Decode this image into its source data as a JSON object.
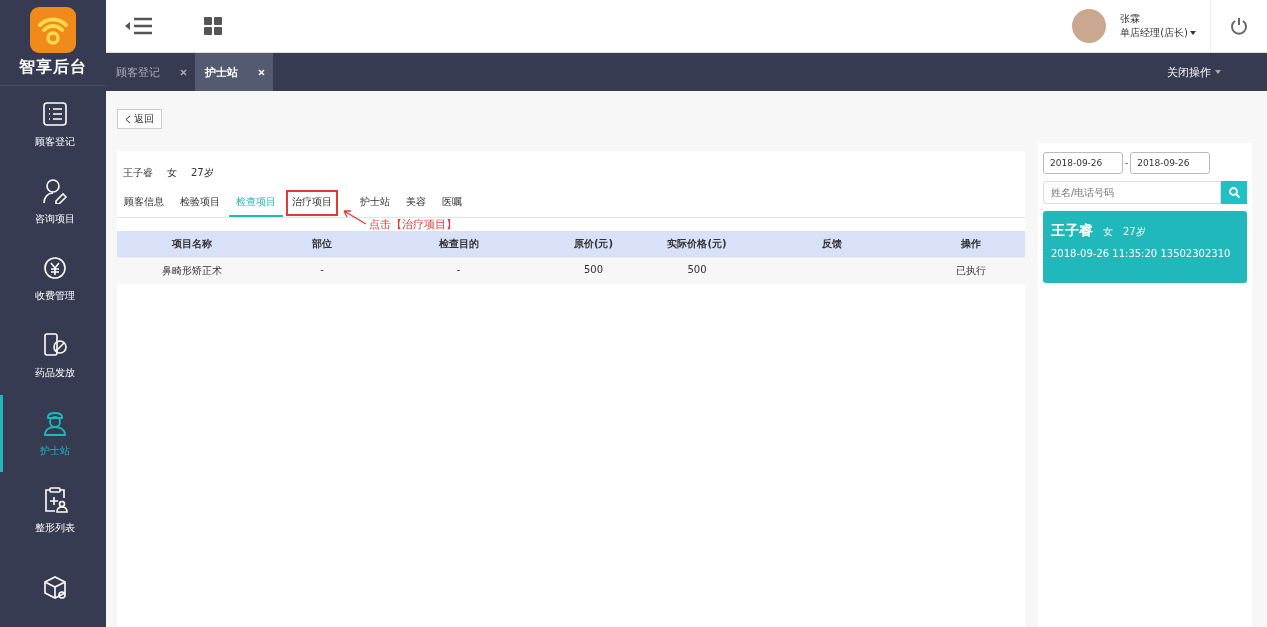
{
  "logo": {
    "title": "智享后台"
  },
  "sidebar": {
    "items": [
      {
        "label": "顾客登记",
        "selected": false
      },
      {
        "label": "咨询项目",
        "selected": false
      },
      {
        "label": "收费管理",
        "selected": false
      },
      {
        "label": "药品发放",
        "selected": false
      },
      {
        "label": "护士站",
        "selected": true
      },
      {
        "label": "整形列表",
        "selected": false
      },
      {
        "selected": false
      }
    ]
  },
  "header": {
    "user_name": "张霖",
    "user_role": "单店经理(店长)"
  },
  "page_tabs": {
    "items": [
      {
        "label": "顾客登记",
        "selected": false
      },
      {
        "label": "护士站",
        "selected": true
      }
    ],
    "close_all": "关闭操作"
  },
  "back_button": "返回",
  "patient": {
    "name": "王子睿",
    "gender": "女",
    "age": "27岁"
  },
  "tabs": [
    {
      "label": "顾客信息",
      "selected": false,
      "highlighted": false
    },
    {
      "label": "检验项目",
      "selected": false,
      "highlighted": false
    },
    {
      "label": "检查项目",
      "selected": true,
      "highlighted": false
    },
    {
      "label": "治疗项目",
      "selected": false,
      "highlighted": true
    },
    {
      "label": "护士站",
      "selected": false,
      "highlighted": false
    },
    {
      "label": "美容",
      "selected": false,
      "highlighted": false
    },
    {
      "label": "医嘱",
      "selected": false,
      "highlighted": false
    }
  ],
  "annotation": {
    "text": "点击【治疗项目】"
  },
  "table": {
    "columns": [
      "项目名称",
      "部位",
      "检查目的",
      "原价(元)",
      "实际价格(元)",
      "反馈",
      "操作"
    ],
    "rows": [
      [
        "鼻畸形矫正术",
        "-",
        "-",
        "500",
        "500",
        "",
        "已执行"
      ]
    ]
  },
  "filter": {
    "date_from": "2018-09-26",
    "separator": "-",
    "date_to": "2018-09-26",
    "search_placeholder": "姓名/电话号码"
  },
  "patient_cards": [
    {
      "name": "王子睿",
      "gender": "女",
      "age": "27岁",
      "time": "2018-09-26 11:35:20",
      "phone": "13502302310"
    }
  ]
}
